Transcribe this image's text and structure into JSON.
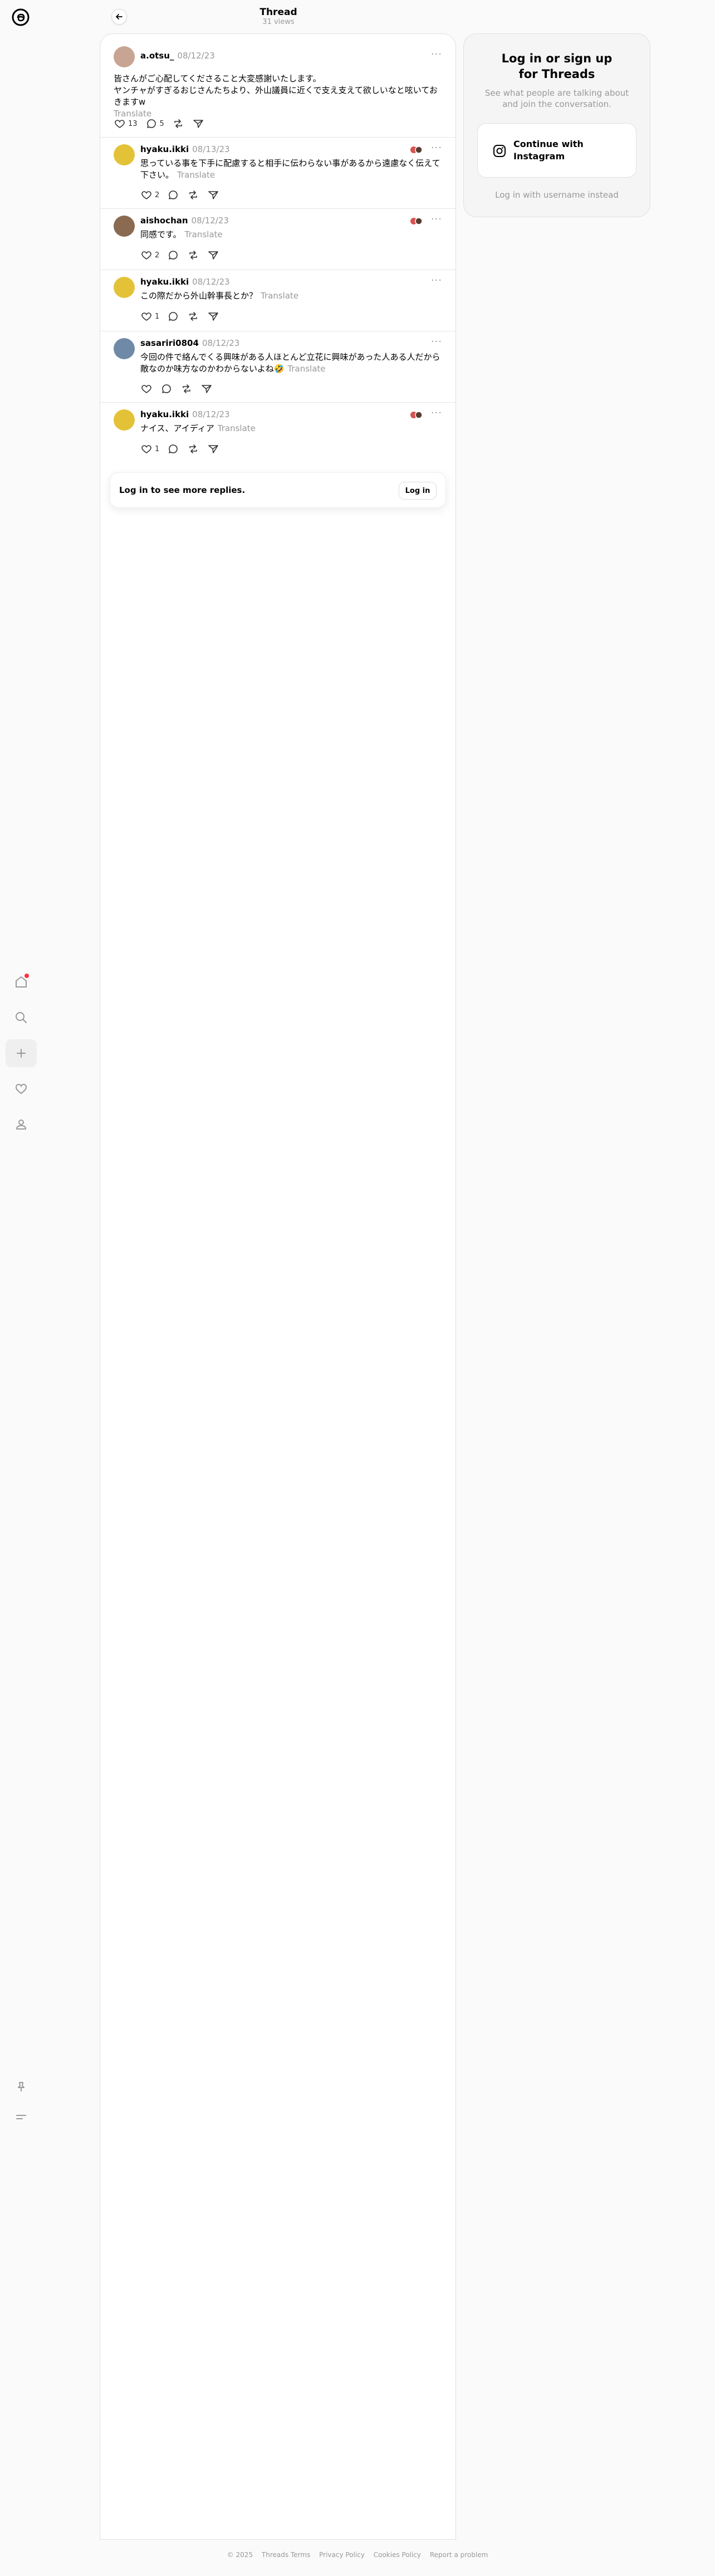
{
  "header": {
    "title": "Thread",
    "views": "31 views"
  },
  "posts": [
    {
      "username": "a.otsu_",
      "date": "08/12/23",
      "text": [
        "皆さんがご心配してくださること大変感謝いたします。",
        "ヤンチャがすぎるおじさんたちより、外山議員に近くで支え支えて欲しいなと呟いておきますw"
      ],
      "translate": "Translate",
      "likes": "13",
      "replies": "5",
      "has_reactor": false
    },
    {
      "username": "hyaku.ikki",
      "date": "08/13/23",
      "text": [
        "思っている事を下手に配慮すると相手に伝わらない事があるから遠慮なく伝えて",
        "下さい。"
      ],
      "translate": "Translate",
      "likes": "2",
      "replies": "",
      "has_reactor": true
    },
    {
      "username": "aishochan",
      "date": "08/12/23",
      "text": [
        "同感です。"
      ],
      "translate": "Translate",
      "likes": "2",
      "replies": "",
      "has_reactor": true
    },
    {
      "username": "hyaku.ikki",
      "date": "08/12/23",
      "text": [
        "この際だから外山幹事長とか？"
      ],
      "translate": "Translate",
      "likes": "1",
      "replies": "",
      "has_reactor": false
    },
    {
      "username": "sasariri0804",
      "date": "08/12/23",
      "text": [
        "今回の件で絡んでくる興味がある人ほとんど立花に興味があった人ある人だから敵なのか味方なのかわからないよね🤣"
      ],
      "translate": "Translate",
      "likes": "",
      "replies": "",
      "has_reactor": false
    },
    {
      "username": "hyaku.ikki",
      "date": "08/12/23",
      "text": [
        "ナイス、アイディア"
      ],
      "translate": "Translate",
      "likes": "1",
      "replies": "",
      "has_reactor": true
    }
  ],
  "login_card": {
    "text": "Log in to see more replies.",
    "button": "Log in"
  },
  "side": {
    "title_line1": "Log in or sign up",
    "title_line2": "for Threads",
    "sub": "See what people are talking about and join the conversation.",
    "ig_label": "Continue with Instagram",
    "username_link": "Log in with username instead"
  },
  "footer": [
    "© 2025",
    "Threads Terms",
    "Privacy Policy",
    "Cookies Policy",
    "Report a problem"
  ],
  "icons": [
    "threads-logo",
    "home-icon",
    "search-icon",
    "plus-icon",
    "heart-icon",
    "profile-icon",
    "pin-icon",
    "menu-icon",
    "back-arrow-icon",
    "like-icon",
    "reply-icon",
    "repost-icon",
    "share-icon",
    "instagram-icon"
  ]
}
